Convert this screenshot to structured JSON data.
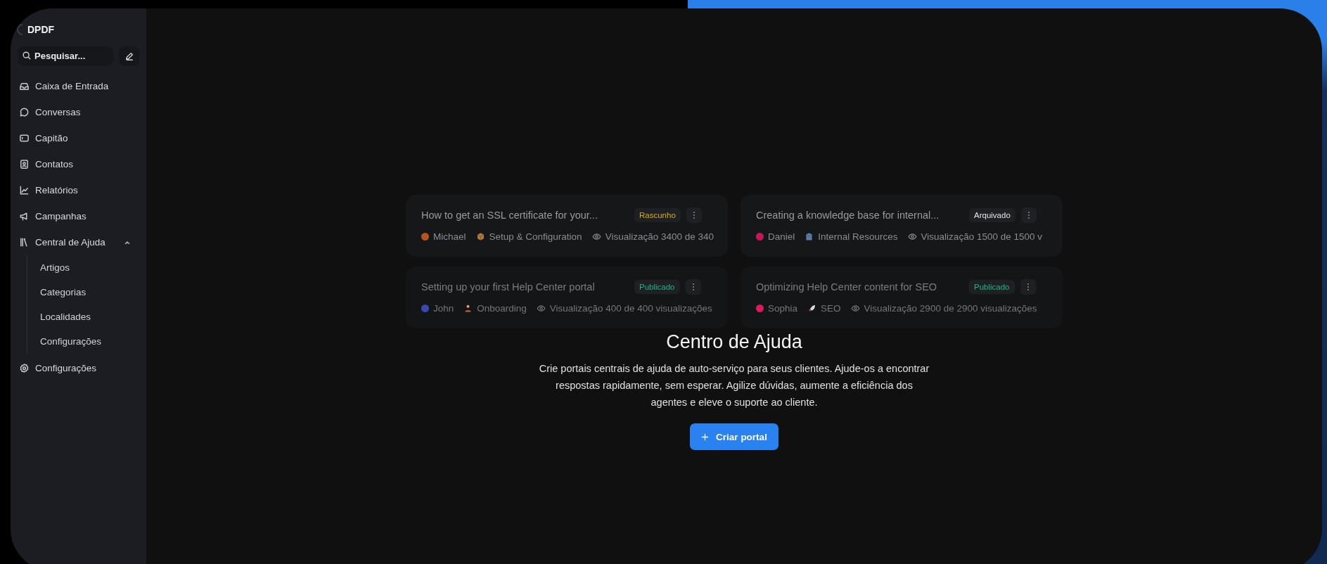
{
  "sidebar": {
    "brand": "DPDF",
    "search": {
      "placeholder": "Pesquisar..."
    },
    "items": [
      {
        "label": "Caixa de Entrada"
      },
      {
        "label": "Conversas"
      },
      {
        "label": "Capitão"
      },
      {
        "label": "Contatos"
      },
      {
        "label": "Relatórios"
      },
      {
        "label": "Campanhas"
      },
      {
        "label": "Central de Ajuda",
        "expanded": true,
        "children": [
          {
            "label": "Artigos"
          },
          {
            "label": "Categorias"
          },
          {
            "label": "Localidades"
          },
          {
            "label": "Configurações"
          }
        ]
      },
      {
        "label": "Configurações"
      }
    ]
  },
  "articles": [
    {
      "title": "How to get an SSL certificate for your...",
      "badge": {
        "label": "Rascunho",
        "color": "#d9a91c"
      },
      "author": "Michael",
      "color": "#b5541c",
      "category": "Setup & Configuration",
      "views": "Visualização 3400 de 340"
    },
    {
      "title": "Creating a knowledge base for internal...",
      "badge": {
        "label": "Arquivado",
        "color": "#e6e6e8"
      },
      "author": "Daniel",
      "color": "#c2185b",
      "category": "Internal Resources",
      "views": "Visualização 1500 de 1500 v"
    },
    {
      "title": "Setting up your first Help Center portal",
      "badge": {
        "label": "Publicado",
        "color": "#22b38a"
      },
      "author": "John",
      "color": "#3949ab",
      "category": "Onboarding",
      "views": "Visualização 400 de 400 visualizações"
    },
    {
      "title": "Optimizing Help Center content for SEO",
      "badge": {
        "label": "Publicado",
        "color": "#22b38a"
      },
      "author": "Sophia",
      "color": "#d81b60",
      "category": "SEO",
      "views": "Visualização 2900 de 2900 visualizações"
    }
  ],
  "empty_state": {
    "title": "Centro de Ajuda",
    "description": "Crie portais centrais de ajuda de auto-serviço para seus clientes. Ajude-os a encontrar respostas rapidamente, sem esperar. Agilize dúvidas, aumente a eficiência dos agentes e eleve o suporte ao cliente.",
    "button": "Criar portal"
  }
}
